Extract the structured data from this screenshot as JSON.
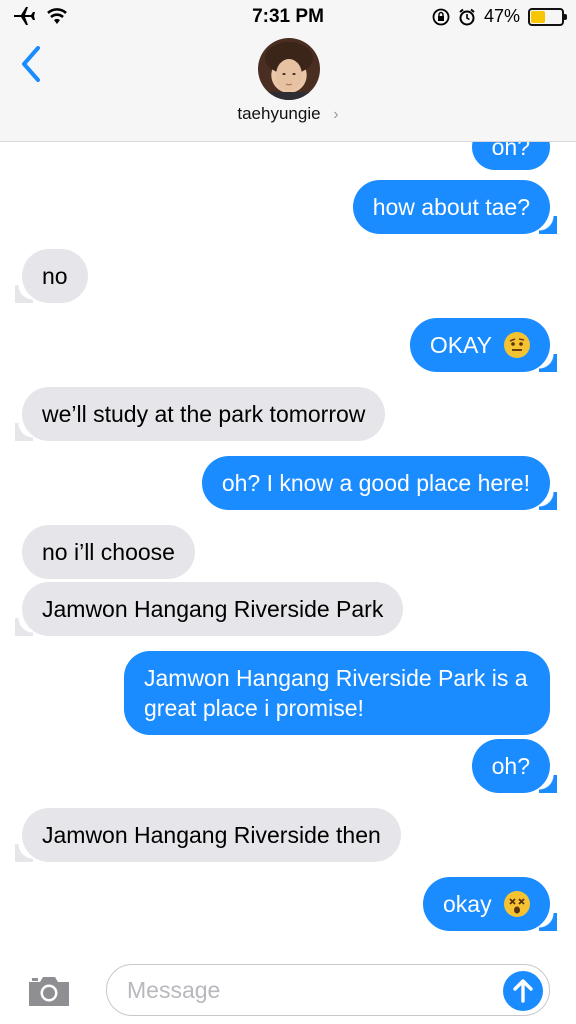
{
  "status_bar": {
    "time": "7:31 PM",
    "battery_percent_text": "47%",
    "battery_level": 0.47,
    "icons": [
      "airplane-icon",
      "wifi-icon",
      "orientation-lock-icon",
      "alarm-icon",
      "battery-icon"
    ]
  },
  "header": {
    "contact_name": "taehyungie",
    "chevron": "›",
    "back_icon": "back-chevron-icon"
  },
  "messages": [
    {
      "dir": "out",
      "text": "oh?"
    },
    {
      "dir": "out",
      "text": "how about tae?"
    },
    {
      "dir": "in",
      "text": "no"
    },
    {
      "dir": "out",
      "text": "OKAY",
      "emoji": "raised-eyebrow-emoji"
    },
    {
      "dir": "in",
      "text": "we’ll study at the park tomorrow"
    },
    {
      "dir": "out",
      "text": "oh? I know a good place here!"
    },
    {
      "dir": "in",
      "text": "no i’ll choose"
    },
    {
      "dir": "in",
      "text": "Jamwon Hangang Riverside Park"
    },
    {
      "dir": "out",
      "text": "Jamwon Hangang Riverside Park is a great place i promise!"
    },
    {
      "dir": "out",
      "text": "oh?"
    },
    {
      "dir": "in",
      "text": "Jamwon Hangang Riverside then"
    },
    {
      "dir": "out",
      "text": "okay",
      "emoji": "dizzy-face-emoji"
    }
  ],
  "input_bar": {
    "placeholder": "Message",
    "camera_icon": "camera-icon",
    "send_icon": "send-arrow-icon"
  },
  "colors": {
    "outgoing_bubble": "#1a8cff",
    "incoming_bubble": "#e6e5ea",
    "accent": "#1a8cff"
  }
}
